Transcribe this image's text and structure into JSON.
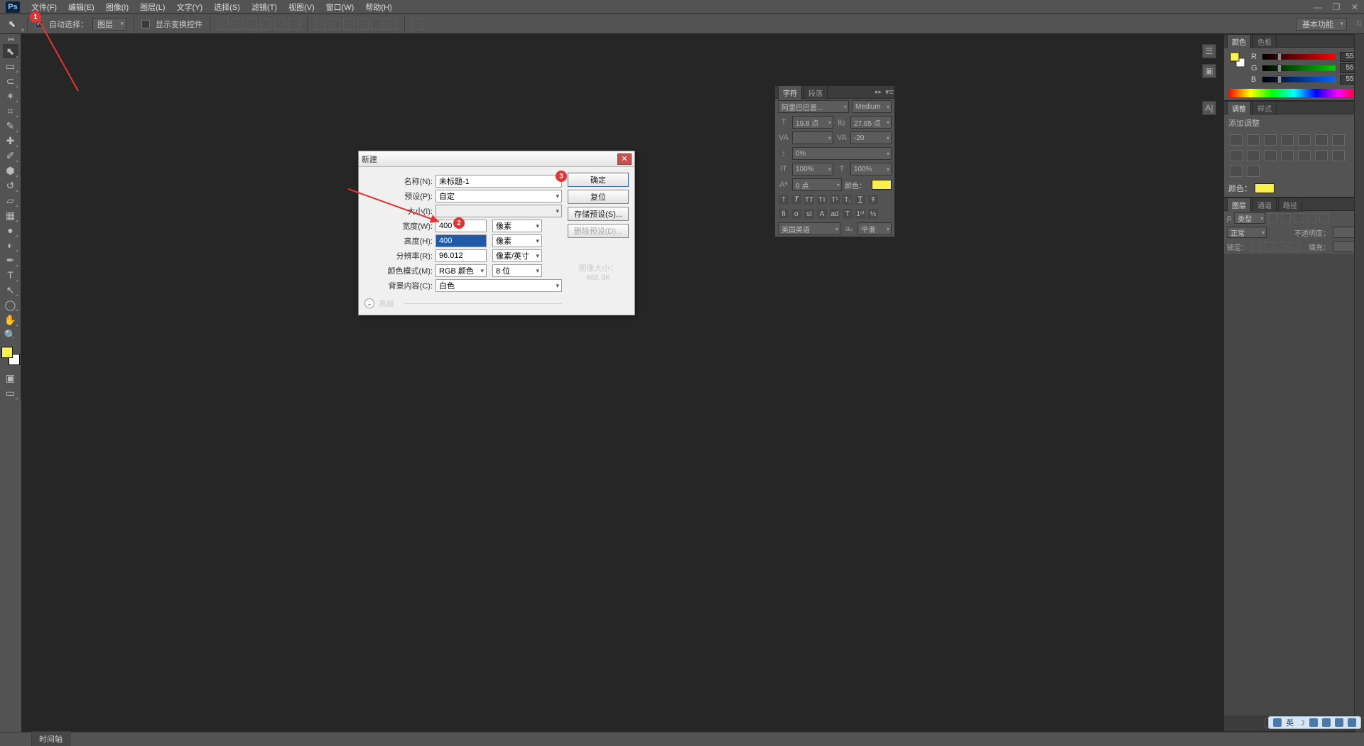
{
  "menu": {
    "items": [
      "文件(F)",
      "编辑(E)",
      "图像(I)",
      "图层(L)",
      "文字(Y)",
      "选择(S)",
      "滤镜(T)",
      "视图(V)",
      "窗口(W)",
      "帮助(H)"
    ]
  },
  "optbar": {
    "auto_select_label": "自动选择：",
    "auto_select_value": "图层",
    "show_transform": "显示变换控件",
    "workspace": "基本功能"
  },
  "status": {
    "tab": "时间轴"
  },
  "charpanel": {
    "tabs": [
      "字符",
      "段落"
    ],
    "font": "阿里巴巴普...",
    "weight": "Medium",
    "size": "19.8 点",
    "leading": "27.65 点",
    "tracking": "-20",
    "vscale": "100%",
    "hscale": "100%",
    "baseline": "0 点",
    "color_label": "颜色：",
    "lang": "美国英语",
    "aa": "平滑"
  },
  "color": {
    "tabs": [
      "颜色",
      "色板"
    ],
    "r": "55",
    "g": "55",
    "b": "55"
  },
  "adjust": {
    "tabs": [
      "调整",
      "样式"
    ],
    "add_label": "添加调整"
  },
  "layers": {
    "tabs": [
      "图层",
      "通道",
      "路径"
    ],
    "filter": "类型",
    "blend": "正常",
    "opacity": "不透明度：",
    "lock": "锁定："
  },
  "dialog": {
    "title": "新建",
    "labels": {
      "name": "名称(N):",
      "preset": "预设(P):",
      "size": "大小(I):",
      "width": "宽度(W):",
      "height": "高度(H):",
      "res": "分辨率(R):",
      "mode": "颜色模式(M):",
      "bg": "背景内容(C):",
      "advanced": "高级"
    },
    "values": {
      "name": "未标题-1",
      "preset": "自定",
      "size": "",
      "width": "400",
      "height": "400",
      "res": "96.012",
      "mode": "RGB 颜色",
      "depth": "8 位",
      "bg": "白色"
    },
    "units": {
      "width": "像素",
      "height": "像素",
      "res": "像素/英寸"
    },
    "buttons": {
      "ok": "确定",
      "reset": "复位",
      "save": "存储预设(S)...",
      "delete": "删除预设(D)..."
    },
    "info": {
      "label": "图像大小：",
      "value": "468.8K"
    }
  },
  "annotations": {
    "b1": "1",
    "b2": "2",
    "b3": "3"
  },
  "tray": {
    "ime": "英"
  }
}
